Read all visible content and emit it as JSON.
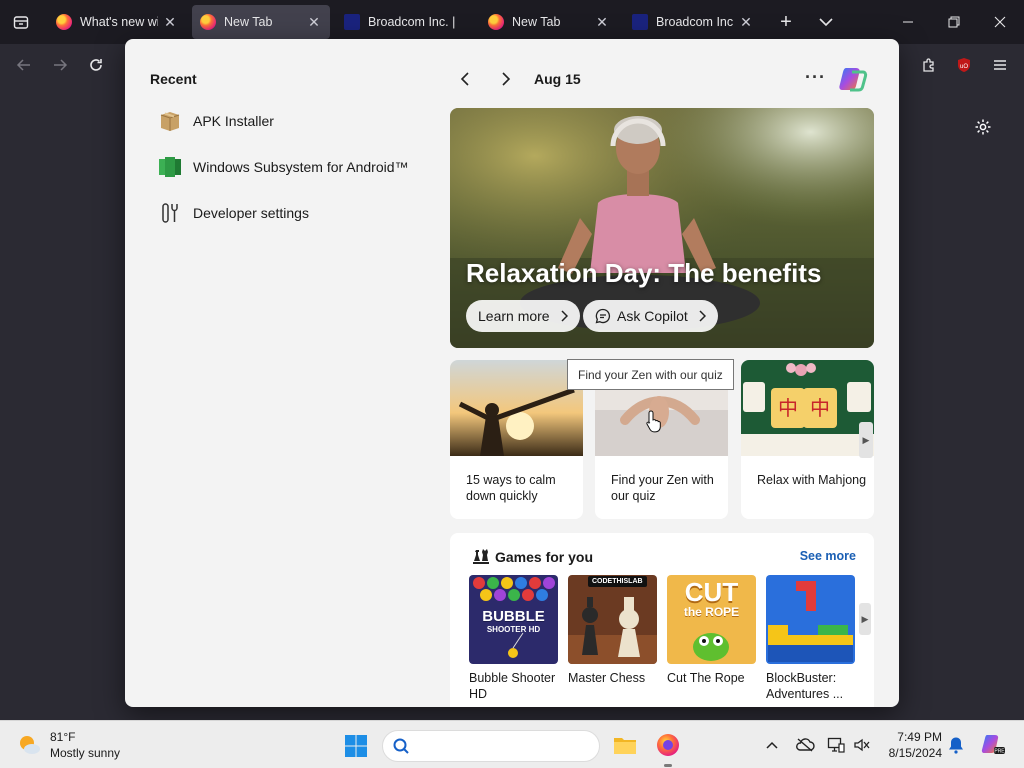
{
  "browser": {
    "tabs": [
      {
        "title": "What's new with",
        "favicon": "firefox-icon",
        "active": false
      },
      {
        "title": "New Tab",
        "favicon": "firefox-icon",
        "active": true
      },
      {
        "title": "Broadcom Inc. |",
        "favicon": "broadcom-icon",
        "active": false
      },
      {
        "title": "New Tab",
        "favicon": "firefox-icon",
        "active": false
      },
      {
        "title": "Broadcom Inc. |",
        "favicon": "broadcom-icon",
        "active": false
      }
    ],
    "new_tab_symbol": "+",
    "close_symbol": "✕"
  },
  "panel": {
    "recent_title": "Recent",
    "recent_items": [
      {
        "label": "APK Installer",
        "icon": "package-icon"
      },
      {
        "label": "Windows Subsystem for Android™",
        "icon": "android-subsystem-icon"
      },
      {
        "label": "Developer settings",
        "icon": "developer-settings-icon"
      }
    ],
    "date": "Aug 15",
    "more_symbol": "···",
    "hero": {
      "title": "Relaxation Day: The benefits",
      "learn_more": "Learn more",
      "ask_copilot": "Ask Copilot"
    },
    "cards": [
      {
        "caption": "15 ways to calm down quickly"
      },
      {
        "caption": "Find your Zen with our quiz"
      },
      {
        "caption": "Relax with Mahjong"
      }
    ],
    "tooltip": "Find your Zen with our quiz",
    "games": {
      "title": "Games for you",
      "see_more": "See more",
      "items": [
        {
          "name": "Bubble Shooter HD",
          "thumb_text": "BUBBLE",
          "thumb_sub": "SHOOTER HD"
        },
        {
          "name": "Master Chess",
          "thumb_text": "CODETHISLAB"
        },
        {
          "name": "Cut The Rope",
          "thumb_text": "CUT",
          "thumb_sub": "the ROPE"
        },
        {
          "name": "BlockBuster: Adventures ..."
        }
      ]
    }
  },
  "taskbar": {
    "temperature": "81°F",
    "condition": "Mostly sunny",
    "time": "7:49 PM",
    "date": "8/15/2024"
  },
  "colors": {
    "accent_link": "#1a5fb4",
    "chrome_dark": "#1c1b22",
    "toolbar": "#2b2a33",
    "panel_bg": "#f3f3f3"
  }
}
